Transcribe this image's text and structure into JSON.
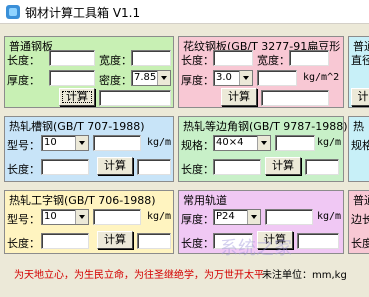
{
  "window": {
    "title": "钢材计算工具箱 V1.1"
  },
  "colors": {
    "green": "#c8f0b4",
    "pink": "#f8c8d4",
    "cyan": "#c8f0f8",
    "blue": "#c8e4f8",
    "yellow": "#fff4c0",
    "magenta": "#f0c8f4",
    "status_red": "#d40000"
  },
  "panels": {
    "plain_plate": {
      "title": "普通钢板",
      "length_label": "长度：",
      "width_label": "宽度：",
      "thickness_label": "厚度：",
      "density_label": "密度：",
      "density_value": "7.85",
      "calc_label": "计算"
    },
    "checker_plate": {
      "title": "花纹钢板(GB/T 3277-91扁豆形",
      "length_label": "长度：",
      "width_label": "宽度：",
      "thickness_label": "厚度：",
      "thickness_value": "3.0",
      "unit": "kg/m^2",
      "calc_label": "计算"
    },
    "partial_top": {
      "title": "普通",
      "line2": "直径",
      "btn": "计"
    },
    "channel": {
      "title": "热轧槽钢(GB/T 707-1988)",
      "model_label": "型号：",
      "model_value": "10",
      "unit": "kg/m",
      "length_label": "长度：",
      "calc_label": "计算"
    },
    "angle": {
      "title": "热轧等边角钢(GB/T 9787-1988)",
      "spec_label": "规格：",
      "spec_value": "40×4",
      "unit": "kg/m",
      "length_label": "长度：",
      "calc_label": "计算"
    },
    "partial_mid": {
      "title": "热",
      "line2": "规格"
    },
    "ibeam": {
      "title": "热轧工字钢(GB/T 706-1988)",
      "model_label": "型号：",
      "model_value": "10",
      "unit": "kg/m",
      "length_label": "长度：",
      "calc_label": "计算"
    },
    "rail": {
      "title": "常用轨道",
      "thickness_label": "厚度：",
      "thickness_value": "P24",
      "unit": "kg/m",
      "length_label": "长度：",
      "calc_label": "计算"
    },
    "partial_bot": {
      "title": "普通",
      "line2": "边长",
      "line3": "长度"
    }
  },
  "status": {
    "slogan": "为天地立心，为生民立命，为往圣继绝学，为万世开太平",
    "unit_note": "未注单位：mm,kg"
  },
  "watermark": "系统之家"
}
